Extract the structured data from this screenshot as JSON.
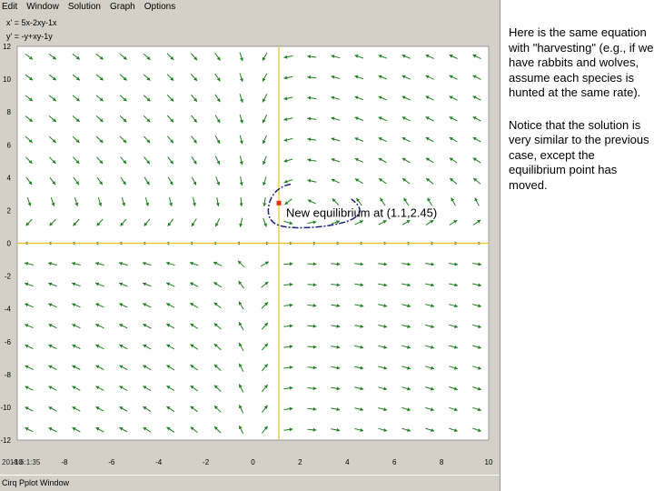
{
  "menu": [
    "Edit",
    "Window",
    "Solution",
    "Graph",
    "Options"
  ],
  "equations": [
    "x' = 5x-2xy-1x",
    "y' = -y+xy-1y"
  ],
  "chart_data": {
    "type": "vector_field",
    "equations": [
      "x' = 5x-2xy-1x",
      "y' = -y+xy-1y"
    ],
    "xlim": [
      -10,
      10
    ],
    "ylim": [
      -12,
      12
    ],
    "xticks": [
      -10,
      -8,
      -6,
      -4,
      -2,
      0,
      2,
      4,
      6,
      8,
      10
    ],
    "yticks": [
      -12,
      -10,
      -8,
      -6,
      -4,
      -2,
      0,
      2,
      4,
      6,
      8,
      10,
      12
    ],
    "xlabel": "x",
    "ylabel": "",
    "equilibrium": {
      "x": 1.1,
      "y": 2.45,
      "label": "New equilibrium at (1.1,2.45)"
    },
    "solution_start": [
      1.6,
      3.6
    ],
    "colors": {
      "arrows": "#1f7f1f",
      "axes": "#f0c020",
      "solution": "#1a237e",
      "equilibrium": "#e03010"
    }
  },
  "status_time": "2018 6:1:35",
  "window_label": "Cirq Pplot Window",
  "notes": [
    "Here is the same equation with \"harvesting\" (e.g., if we have rabbits and wolves, assume each species is hunted at the same rate).",
    "Notice that the solution is very similar to the previous case, except the equilibrium point has moved."
  ]
}
